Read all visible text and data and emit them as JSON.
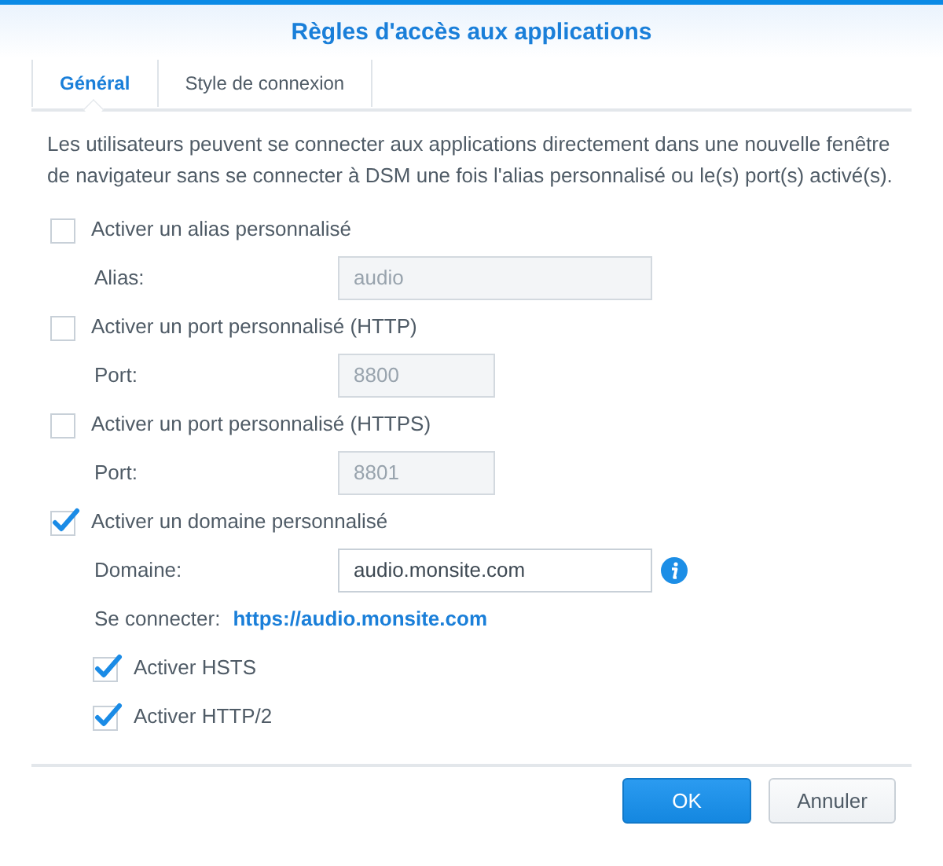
{
  "window": {
    "title": "Règles d'accès aux applications"
  },
  "tabs": [
    {
      "label": "Général",
      "selected": true
    },
    {
      "label": "Style de connexion",
      "selected": false
    }
  ],
  "description": "Les utilisateurs peuvent se connecter aux applications directement dans une nouvelle fenêtre de navigateur sans se connecter à DSM une fois l'alias personnalisé ou le(s) port(s) activé(s).",
  "options": [
    {
      "kind": "checkbox",
      "label": "Activer un alias personnalisé",
      "checked": false,
      "children": [
        {
          "kind": "text-field",
          "label": "Alias:",
          "value": "audio",
          "disabled": true
        }
      ]
    },
    {
      "kind": "checkbox",
      "label": "Activer un port personnalisé (HTTP)",
      "checked": false,
      "children": [
        {
          "kind": "port-field",
          "label": "Port:",
          "value": "8800",
          "disabled": true
        }
      ]
    },
    {
      "kind": "checkbox",
      "label": "Activer un port personnalisé (HTTPS)",
      "checked": false,
      "children": [
        {
          "kind": "port-field",
          "label": "Port:",
          "value": "8801",
          "disabled": true
        }
      ]
    },
    {
      "kind": "checkbox",
      "label": "Activer un domaine personnalisé",
      "checked": true,
      "children": [
        {
          "kind": "text-field",
          "label": "Domaine:",
          "value": "audio.monsite.com",
          "disabled": false,
          "help": true
        },
        {
          "kind": "link",
          "label": "Se connecter:",
          "link": "https://audio.monsite.com"
        },
        {
          "kind": "checkbox",
          "label": "Activer HSTS",
          "checked": true
        },
        {
          "kind": "checkbox",
          "label": "Activer HTTP/2",
          "checked": true
        }
      ]
    }
  ],
  "buttons": [
    {
      "label": "OK",
      "kind": "primary"
    },
    {
      "label": "Annuler",
      "kind": "secondary"
    }
  ]
}
